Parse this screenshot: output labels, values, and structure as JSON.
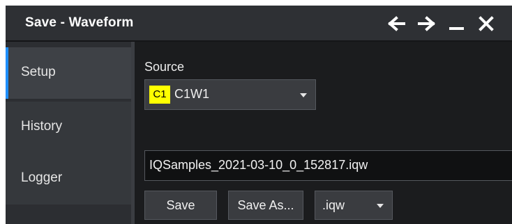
{
  "window": {
    "title": "Save - Waveform"
  },
  "titlebar_icons": [
    "arrow-left-icon",
    "arrow-right-icon",
    "minimize-icon",
    "close-icon"
  ],
  "sidebar": {
    "items": [
      {
        "label": "Setup",
        "active": true
      },
      {
        "label": "History",
        "active": false
      },
      {
        "label": "Logger",
        "active": false
      }
    ]
  },
  "setup": {
    "source_label": "Source",
    "source_badge": "C1",
    "source_value": "C1W1",
    "filename": "IQSamples_2021-03-10_0_152817.iqw",
    "save_label": "Save",
    "save_as_label": "Save As...",
    "extension": ".iqw"
  },
  "colors": {
    "accent": "#1e8fff",
    "badge": "#ffff00",
    "background": "#1b1c1e",
    "titlebar": "#2e3034"
  }
}
